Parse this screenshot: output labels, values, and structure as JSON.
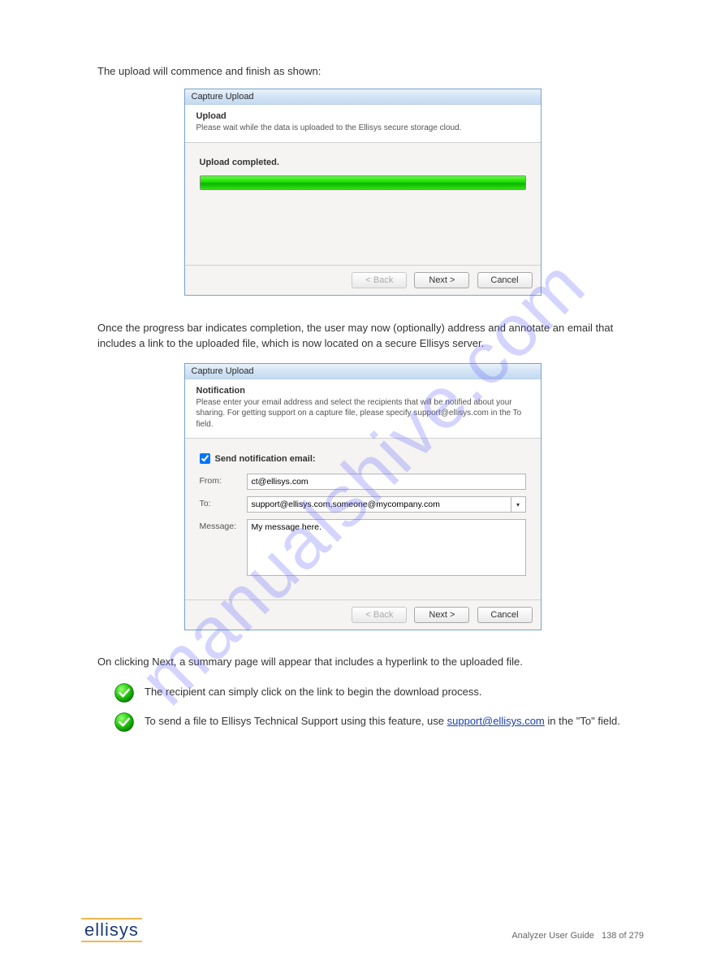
{
  "watermark": "manualshive.com",
  "intro": "The upload will commence and finish as shown:",
  "dialog1": {
    "title": "Capture Upload",
    "header_title": "Upload",
    "header_desc": "Please wait while the data is uploaded to the Ellisys secure storage cloud.",
    "status": "Upload completed.",
    "back": "< Back",
    "next": "Next >",
    "cancel": "Cancel"
  },
  "between": "Once the progress bar indicates completion, the user may now (optionally) address and annotate an email that includes a link to the uploaded file, which is now located on a secure Ellisys server.",
  "dialog2": {
    "title": "Capture Upload",
    "header_title": "Notification",
    "header_desc": "Please enter your email address and select the recipients that will be notified about your sharing.  For getting support on a capture file, please specify support@ellisys.com in the To field.",
    "checkbox_label": "Send notification email:",
    "from_label": "From:",
    "from_value": "ct@ellisys.com",
    "to_label": "To:",
    "to_value": "support@ellisys.com,someone@mycompany.com",
    "message_label": "Message:",
    "message_value": "My message here.",
    "back": "< Back",
    "next": "Next >",
    "cancel": "Cancel"
  },
  "post": "On clicking Next, a summary page will appear that includes a hyperlink to the uploaded file.",
  "tips": [
    "The recipient can simply click on the link to begin the download process.",
    "To send a file to Ellisys Technical Support using this feature, use "
  ],
  "support_email": "support@ellisys.com",
  "tip2_suffix": "in the \"To\" field.",
  "logo": "ellisys",
  "page_text": "Analyzer User Guide",
  "page_num": "138 of 279"
}
